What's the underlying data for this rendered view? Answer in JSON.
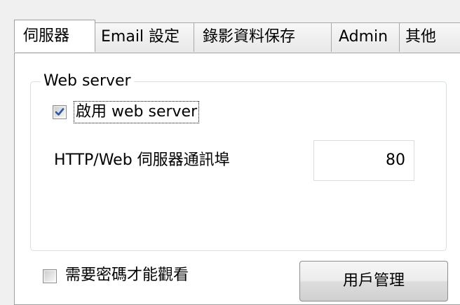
{
  "tabs": [
    {
      "label": "伺服器",
      "active": true
    },
    {
      "label": "Email 設定",
      "active": false
    },
    {
      "label": "錄影資料保存",
      "active": false
    },
    {
      "label": "Admin",
      "active": false
    },
    {
      "label": "其他",
      "active": false
    }
  ],
  "web_server": {
    "group_title": "Web server",
    "enable_label": "啟用 web server",
    "enable_checked": true,
    "port_label": "HTTP/Web 伺服器通訊埠",
    "port_value": "80"
  },
  "require_password": {
    "label": "需要密碼才能觀看",
    "checked": false
  },
  "user_management_button": "用戶管理",
  "colors": {
    "panel_bg": "#ffffff",
    "window_bg": "#f0f0f0",
    "check_mark": "#2b55a6",
    "groupbox_border": "#d5dfe5"
  },
  "icons": {
    "checkbox_checked": "check-icon"
  }
}
